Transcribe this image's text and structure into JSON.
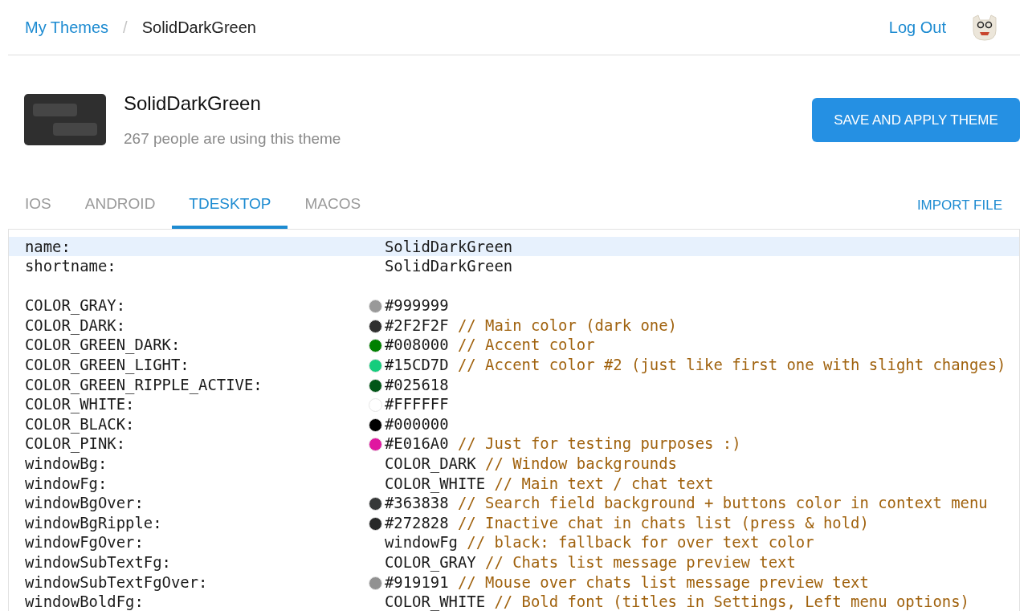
{
  "breadcrumb": {
    "parent": "My Themes",
    "separator": "/",
    "current": "SolidDarkGreen"
  },
  "header": {
    "logout": "Log Out"
  },
  "theme": {
    "name": "SolidDarkGreen",
    "users": "267 people are using this theme",
    "save_button": "SAVE AND APPLY THEME"
  },
  "tabs": [
    {
      "label": "IOS",
      "selected": false
    },
    {
      "label": "ANDROID",
      "selected": false
    },
    {
      "label": "TDESKTOP",
      "selected": true
    },
    {
      "label": "MACOS",
      "selected": false
    }
  ],
  "import_button": "IMPORT FILE",
  "editor": {
    "rows": [
      {
        "kind": "entry",
        "key": "name:",
        "value": "SolidDarkGreen",
        "selected": true
      },
      {
        "kind": "entry",
        "key": "shortname:",
        "value": "SolidDarkGreen",
        "selected": false
      },
      {
        "kind": "blank",
        "selected": false
      },
      {
        "kind": "entry",
        "key": "COLOR_GRAY:",
        "color": "#999999",
        "value": "#999999",
        "selected": false
      },
      {
        "kind": "entry",
        "key": "COLOR_DARK:",
        "color": "#2f2f2f",
        "value": "#2F2F2F",
        "comment": "// Main color (dark one)",
        "selected": false
      },
      {
        "kind": "entry",
        "key": "COLOR_GREEN_DARK:",
        "color": "#008000",
        "value": "#008000",
        "comment": "// Accent color",
        "selected": false
      },
      {
        "kind": "entry",
        "key": "COLOR_GREEN_LIGHT:",
        "color": "#15cd7d",
        "value": "#15CD7D",
        "comment": "// Accent color #2 (just like first one with slight changes)",
        "selected": false
      },
      {
        "kind": "entry",
        "key": "COLOR_GREEN_RIPPLE_ACTIVE:",
        "color": "#025618",
        "value": "#025618",
        "selected": false
      },
      {
        "kind": "entry",
        "key": "COLOR_WHITE:",
        "color": "#ffffff",
        "value": "#FFFFFF",
        "selected": false
      },
      {
        "kind": "entry",
        "key": "COLOR_BLACK:",
        "color": "#000000",
        "value": "#000000",
        "selected": false
      },
      {
        "kind": "entry",
        "key": "COLOR_PINK:",
        "color": "#e016a0",
        "value": "#E016A0",
        "comment": "// Just for testing purposes :)",
        "selected": false
      },
      {
        "kind": "entry",
        "key": "windowBg:",
        "value": "COLOR_DARK",
        "comment": "// Window backgrounds",
        "selected": false
      },
      {
        "kind": "entry",
        "key": "windowFg:",
        "value": "COLOR_WHITE",
        "comment": "// Main text / chat text",
        "selected": false
      },
      {
        "kind": "entry",
        "key": "windowBgOver:",
        "color": "#363838",
        "value": "#363838",
        "comment": "// Search field background + buttons color in context menu",
        "selected": false
      },
      {
        "kind": "entry",
        "key": "windowBgRipple:",
        "color": "#272828",
        "value": "#272828",
        "comment": "// Inactive chat in chats list (press & hold)",
        "selected": false
      },
      {
        "kind": "entry",
        "key": "windowFgOver:",
        "value": "windowFg",
        "comment": "// black: fallback for over text color",
        "selected": false
      },
      {
        "kind": "entry",
        "key": "windowSubTextFg:",
        "value": "COLOR_GRAY",
        "comment": "// Chats list message preview text",
        "selected": false
      },
      {
        "kind": "entry",
        "key": "windowSubTextFgOver:",
        "color": "#919191",
        "value": "#919191",
        "comment": "// Mouse over chats list message preview text",
        "selected": false
      },
      {
        "kind": "entry",
        "key": "windowBoldFg:",
        "value": "COLOR_WHITE",
        "comment": "// Bold font (titles in Settings, Left menu options)",
        "selected": false
      }
    ]
  }
}
